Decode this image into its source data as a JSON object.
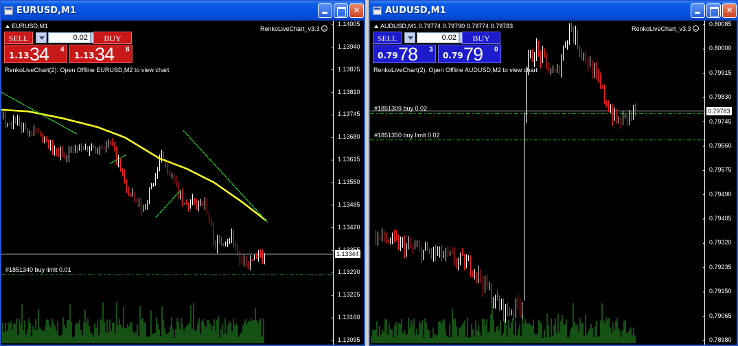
{
  "windows": [
    {
      "title": "EURUSD,M1",
      "symbol_info": "EURUSD,M1",
      "indicator": "RenkoLiveChart_v3.3",
      "message": "RenkoLiveChart(2): Open Offline EURUSD,M2 to view chart",
      "panel": {
        "sell_label": "SELL",
        "buy_label": "BUY",
        "lot": "0.02",
        "bid_big": "1.13",
        "bid_pips": "34",
        "bid_point": "4",
        "ask_big": "1.13",
        "ask_pips": "34",
        "ask_point": "8"
      },
      "price_axis": [
        "1.14005",
        "1.13940",
        "1.13875",
        "1.13810",
        "1.13745",
        "1.13680",
        "1.13615",
        "1.13550",
        "1.13485",
        "1.13420",
        "1.13355",
        "1.13290",
        "1.13225",
        "1.13160",
        "1.13095"
      ],
      "current_price": "1.13344",
      "orders": [
        {
          "label": "#1851340 buy limit 0.01",
          "price": 1.13285
        }
      ]
    },
    {
      "title": "AUDUSD,M1",
      "symbol_info": "AUDUSD,M1  0.79774 0.79790 0.79774 0.79783",
      "indicator": "RenkoLiveChart_v3.3",
      "message": "RenkoLiveChart(2): Open Offline AUDUSD,M2 to view chart",
      "panel": {
        "sell_label": "SELL",
        "buy_label": "BUY",
        "lot": "0.02",
        "bid_big": "0.79",
        "bid_pips": "78",
        "bid_point": "3",
        "ask_big": "0.79",
        "ask_pips": "79",
        "ask_point": "0"
      },
      "price_axis": [
        "0.80085",
        "0.80000",
        "0.79915",
        "0.79830",
        "0.79745",
        "0.79660",
        "0.79575",
        "0.79490",
        "0.79405",
        "0.79320",
        "0.79235",
        "0.79150",
        "0.79065",
        "0.78980"
      ],
      "current_price": "0.79783",
      "orders": [
        {
          "label": "#1851309 buy 0.02",
          "price": 0.79774
        },
        {
          "label": "#1851350 buy limit 0.02",
          "price": 0.79682
        }
      ]
    }
  ],
  "colors": {
    "bull": "#ffffff",
    "bear": "#ff2020",
    "volume": "#2aa12a",
    "ma": "#ffff20",
    "trend": "#20ee20",
    "order_line": "#18a018",
    "grid": "#9a9a9a"
  }
}
